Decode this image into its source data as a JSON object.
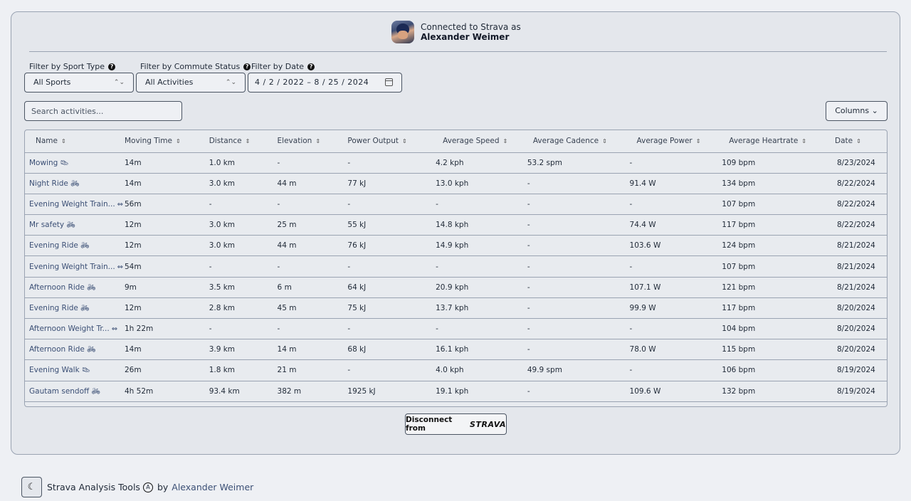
{
  "connection": {
    "line1": "Connected to Strava as",
    "user": "Alexander Weimer"
  },
  "filters": {
    "sport_label": "Filter by Sport Type",
    "sport_value": "All Sports",
    "commute_label": "Filter by Commute Status",
    "commute_value": "All Activities",
    "date_label": "Filter by Date",
    "date_value": "4 / 2 / 2022 – 8 / 25 / 2024"
  },
  "search": {
    "placeholder": "Search activities..."
  },
  "columns_label": "Columns",
  "table": {
    "headers": [
      "Name",
      "Moving Time",
      "Distance",
      "Elevation",
      "Power Output",
      "Average Speed",
      "Average Cadence",
      "Average Power",
      "Average Heartrate",
      "Date"
    ],
    "rows": [
      {
        "name": "Mowing",
        "icon": "shoe-icon",
        "cells": [
          "14m",
          "1.0 km",
          "-",
          "-",
          "4.2 kph",
          "53.2 spm",
          "-",
          "109 bpm",
          "8/23/2024"
        ]
      },
      {
        "name": "Night Ride",
        "icon": "bike-icon",
        "cells": [
          "14m",
          "3.0 km",
          "44 m",
          "77 kJ",
          "13.0 kph",
          "-",
          "91.4 W",
          "134 bpm",
          "8/22/2024"
        ]
      },
      {
        "name": "Evening Weight Train...",
        "icon": "dumbbell-icon",
        "cells": [
          "56m",
          "-",
          "-",
          "-",
          "-",
          "-",
          "-",
          "107 bpm",
          "8/22/2024"
        ]
      },
      {
        "name": "Mr safety",
        "icon": "bike-icon",
        "cells": [
          "12m",
          "3.0 km",
          "25 m",
          "55 kJ",
          "14.8 kph",
          "-",
          "74.4 W",
          "117 bpm",
          "8/22/2024"
        ]
      },
      {
        "name": "Evening Ride",
        "icon": "bike-icon",
        "cells": [
          "12m",
          "3.0 km",
          "44 m",
          "76 kJ",
          "14.9 kph",
          "-",
          "103.6 W",
          "124 bpm",
          "8/21/2024"
        ]
      },
      {
        "name": "Evening Weight Train...",
        "icon": "dumbbell-icon",
        "cells": [
          "54m",
          "-",
          "-",
          "-",
          "-",
          "-",
          "-",
          "107 bpm",
          "8/21/2024"
        ]
      },
      {
        "name": "Afternoon Ride",
        "icon": "bike-icon",
        "cells": [
          "9m",
          "3.5 km",
          "6 m",
          "64 kJ",
          "20.9 kph",
          "-",
          "107.1 W",
          "121 bpm",
          "8/21/2024"
        ]
      },
      {
        "name": "Evening Ride",
        "icon": "bike-icon",
        "cells": [
          "12m",
          "2.8 km",
          "45 m",
          "75 kJ",
          "13.7 kph",
          "-",
          "99.9 W",
          "117 bpm",
          "8/20/2024"
        ]
      },
      {
        "name": "Afternoon Weight Tr...",
        "icon": "dumbbell-icon",
        "cells": [
          "1h 22m",
          "-",
          "-",
          "-",
          "-",
          "-",
          "-",
          "104 bpm",
          "8/20/2024"
        ]
      },
      {
        "name": "Afternoon Ride",
        "icon": "bike-icon",
        "cells": [
          "14m",
          "3.9 km",
          "14 m",
          "68 kJ",
          "16.1 kph",
          "-",
          "78.0 W",
          "115 bpm",
          "8/20/2024"
        ]
      },
      {
        "name": "Evening Walk",
        "icon": "shoe-icon",
        "cells": [
          "26m",
          "1.8 km",
          "21 m",
          "-",
          "4.0 kph",
          "49.9 spm",
          "-",
          "106 bpm",
          "8/19/2024"
        ]
      },
      {
        "name": "Gautam sendoff",
        "icon": "bike-icon",
        "cells": [
          "4h 52m",
          "93.4 km",
          "382 m",
          "1925 kJ",
          "19.1 kph",
          "-",
          "109.6 W",
          "132 bpm",
          "8/19/2024"
        ]
      }
    ]
  },
  "disconnect": {
    "label": "Disconnect from",
    "brand": "STRAVA"
  },
  "footer": {
    "title": "Strava Analysis Tools",
    "by": "by",
    "author": "Alexander Weimer"
  }
}
